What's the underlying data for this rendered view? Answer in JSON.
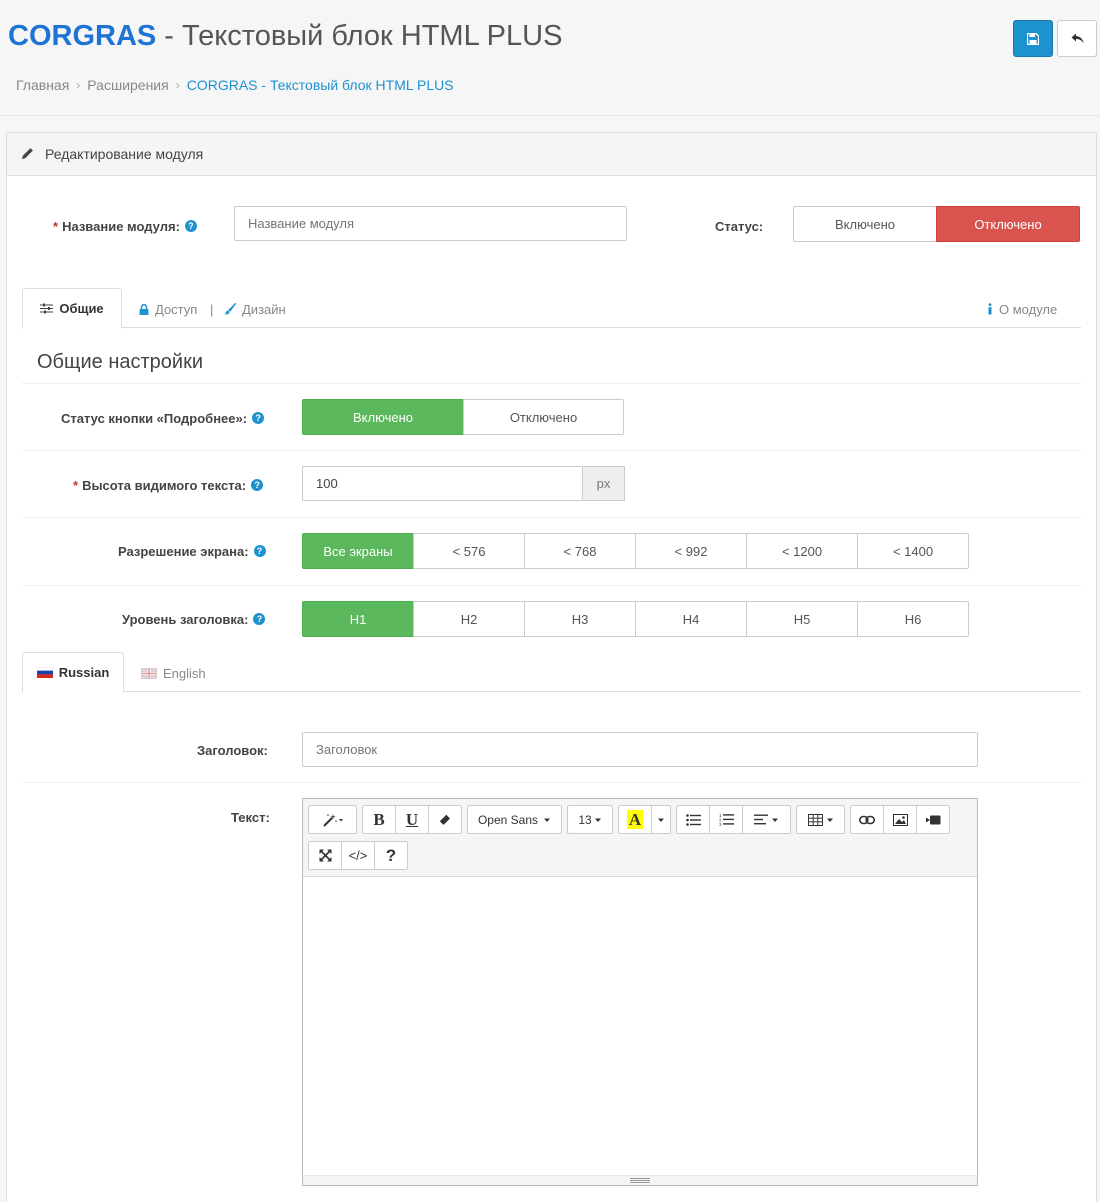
{
  "header": {
    "brand": "CORGRAS",
    "title_rest": " - Текстовый блок HTML PLUS",
    "save_icon": "floppy-disk-icon",
    "back_icon": "reply-arrow-icon",
    "colors": {
      "brand": "#1e74d4",
      "primary": "#1e91cf"
    }
  },
  "breadcrumb": {
    "items": [
      "Главная",
      "Расширения",
      "CORGRAS - Текстовый блок HTML PLUS"
    ]
  },
  "panel": {
    "heading": "Редактирование модуля",
    "heading_icon": "pencil-icon"
  },
  "module": {
    "name_label": "Название модуля:",
    "name_placeholder": "Название модуля",
    "status_label": "Статус:",
    "status_on": "Включено",
    "status_off": "Отключено",
    "status_selected": "Отключено"
  },
  "tabs": {
    "general": "Общие",
    "access": "Доступ",
    "separator": "|",
    "design": "Дизайн",
    "about": "О модуле",
    "active": "Общие"
  },
  "general": {
    "section_title": "Общие настройки",
    "more_btn_label": "Статус кнопки «Подробнее»:",
    "more_on": "Включено",
    "more_off": "Отключено",
    "height_label": "Высота видимого текста:",
    "height_value": "100",
    "height_unit": "px",
    "screen_label": "Разрешение экрана:",
    "screen_options": [
      "Все экраны",
      "< 576",
      "< 768",
      "< 992",
      "< 1200",
      "< 1400"
    ],
    "screen_selected": "Все экраны",
    "heading_label": "Уровень заголовка:",
    "heading_options": [
      "H1",
      "H2",
      "H3",
      "H4",
      "H5",
      "H6"
    ],
    "heading_selected": "H1"
  },
  "languages": {
    "tabs": [
      "Russian",
      "English"
    ],
    "active": "Russian"
  },
  "content": {
    "title_label": "Заголовок:",
    "title_placeholder": "Заголовок",
    "text_label": "Текст:"
  },
  "editor": {
    "font_name": "Open Sans",
    "font_size": "13",
    "bold": "B",
    "underline": "U",
    "color_letter": "A",
    "code": "</>",
    "help": "?"
  }
}
